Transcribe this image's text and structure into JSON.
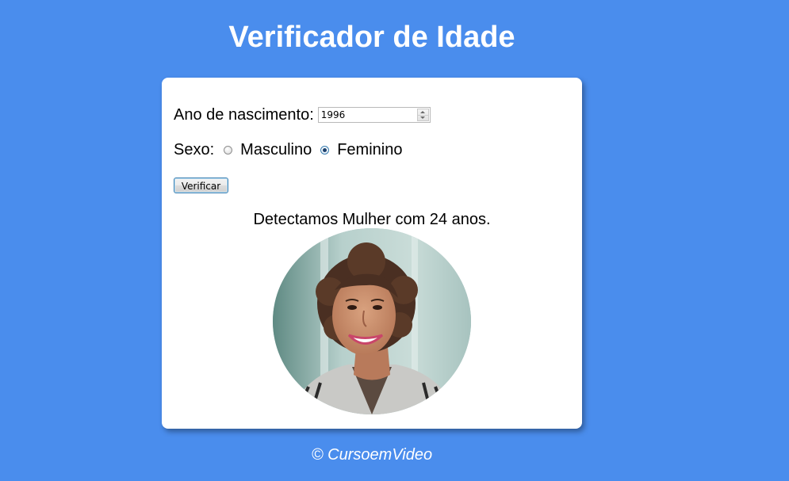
{
  "page": {
    "title": "Verificador de Idade"
  },
  "form": {
    "birth_label": "Ano de nascimento:",
    "birth_value": "1996",
    "sex_label": "Sexo:",
    "options": [
      {
        "label": "Masculino",
        "checked": false
      },
      {
        "label": "Feminino",
        "checked": true
      }
    ],
    "button_label": "Verificar"
  },
  "result": {
    "text": "Detectamos Mulher com 24 anos."
  },
  "footer": {
    "text": "© CursoemVideo"
  },
  "colors": {
    "background": "#4a8ded",
    "card": "#ffffff",
    "title": "#ffffff"
  }
}
